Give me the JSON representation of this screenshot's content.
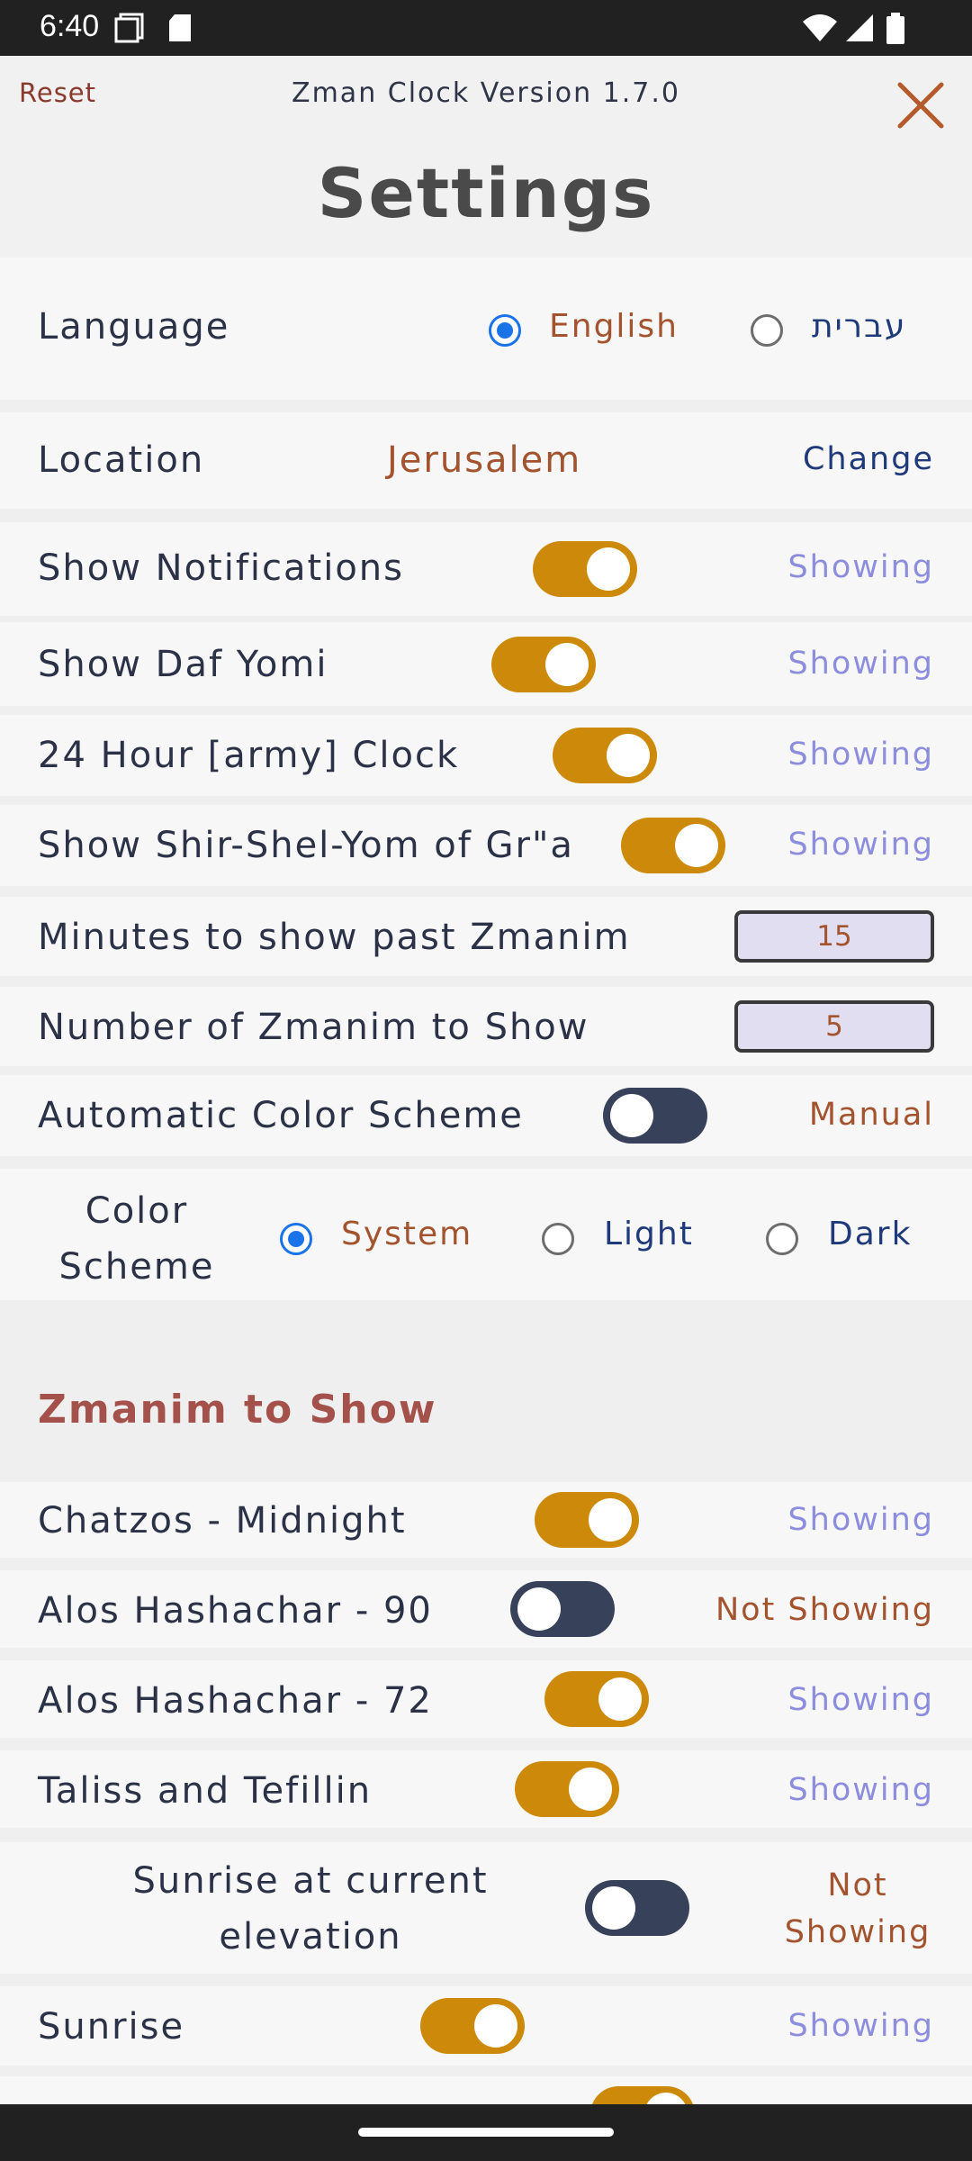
{
  "status_bar": {
    "time": "6:40"
  },
  "header": {
    "reset_label": "Reset",
    "version": "Zman Clock Version 1.7.0",
    "title": "Settings"
  },
  "language": {
    "label": "Language",
    "options": [
      "English",
      "עברית"
    ],
    "selected": "English"
  },
  "location": {
    "label": "Location",
    "value": "Jerusalem",
    "change_label": "Change"
  },
  "settings": {
    "notifications": {
      "label": "Show Notifications",
      "on": true,
      "status": "Showing"
    },
    "daf_yomi": {
      "label": "Show Daf Yomi",
      "on": true,
      "status": "Showing"
    },
    "army_clock": {
      "label": "24 Hour [army] Clock",
      "on": true,
      "status": "Showing"
    },
    "shir_shel_yom": {
      "label": "Show Shir-Shel-Yom of Gr\"a",
      "on": true,
      "status": "Showing"
    },
    "minutes_past": {
      "label": "Minutes to show past Zmanim",
      "value": "15"
    },
    "num_zmanim": {
      "label": "Number of Zmanim to Show",
      "value": "5"
    },
    "auto_color": {
      "label": "Automatic Color Scheme",
      "on": false,
      "status": "Manual"
    }
  },
  "color_scheme": {
    "label": "Color Scheme",
    "options": [
      "System",
      "Light",
      "Dark"
    ],
    "selected": "System"
  },
  "zmanim_section_title": "Zmanim to Show",
  "zmanim": [
    {
      "label": "Chatzos - Midnight",
      "on": true,
      "status": "Showing"
    },
    {
      "label": "Alos Hashachar - 90",
      "on": false,
      "status": "Not Showing"
    },
    {
      "label": "Alos Hashachar - 72",
      "on": true,
      "status": "Showing"
    },
    {
      "label": "Taliss and Tefillin",
      "on": true,
      "status": "Showing"
    },
    {
      "label": "Sunrise at current elevation",
      "on": false,
      "status": "Not Showing"
    },
    {
      "label": "Sunrise",
      "on": true,
      "status": "Showing"
    }
  ],
  "colors": {
    "accent_toggle": "#cd8a0a",
    "toggle_off": "#37415a",
    "showing": "#8d8ddd",
    "not_showing": "#a3532e",
    "radio_selected": "#1a73e8"
  }
}
